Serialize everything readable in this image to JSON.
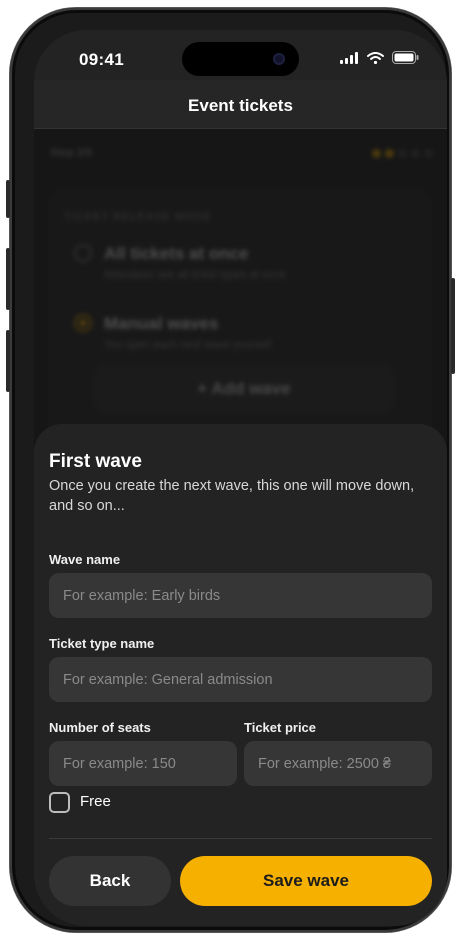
{
  "status_bar": {
    "time": "09:41"
  },
  "nav": {
    "title": "Event tickets"
  },
  "background": {
    "step": "Step 2/5",
    "section_label": "TICKET RELEASE MODE",
    "option_all": {
      "title": "All tickets at once",
      "subtitle": "Attendees see all ticket types at once"
    },
    "option_manual": {
      "title": "Manual waves",
      "subtitle": "You open each next wave yourself"
    },
    "add_wave_label": "+ Add wave"
  },
  "sheet": {
    "title": "First wave",
    "description": "Once you create the next wave, this one will move down, and so on...",
    "wave_name": {
      "label": "Wave name",
      "value": "",
      "placeholder": "For example: Early birds"
    },
    "ticket_type": {
      "label": "Ticket type name",
      "value": "",
      "placeholder": "For example: General admission"
    },
    "seats": {
      "label": "Number of seats",
      "value": "",
      "placeholder": "For example: 150"
    },
    "price": {
      "label": "Ticket price",
      "value": "",
      "placeholder": "For example: 2500 ₴"
    },
    "free_label": "Free",
    "free_checked": false,
    "back_label": "Back",
    "save_label": "Save wave"
  },
  "colors": {
    "accent": "#f6b000",
    "sheet": "#232323",
    "input": "#363636"
  }
}
